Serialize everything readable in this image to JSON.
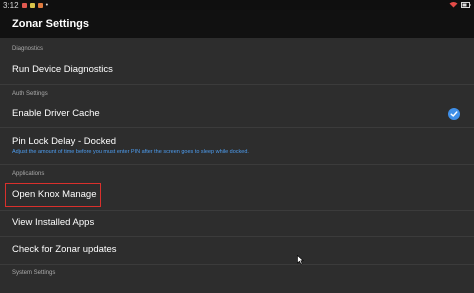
{
  "status_bar": {
    "time": "3:12",
    "left_icons": [
      "notification-icon",
      "notification-icon",
      "notification-icon",
      "more-dots-icon"
    ],
    "right_icons": [
      "wifi-icon",
      "battery-icon"
    ]
  },
  "app_bar": {
    "title": "Zonar Settings"
  },
  "sections": {
    "diagnostics": {
      "header": "Diagnostics",
      "run_diagnostics": "Run Device Diagnostics"
    },
    "auth": {
      "header": "Auth Settings",
      "driver_cache": "Enable Driver Cache",
      "driver_cache_checked": true,
      "pin_lock": "Pin Lock Delay - Docked",
      "pin_lock_sub": "Adjust the amount of time before you must enter PIN after the screen goes to sleep while docked."
    },
    "applications": {
      "header": "Applications",
      "knox": "Open Knox Manage",
      "installed_apps": "View Installed Apps",
      "updates": "Check for Zonar updates"
    },
    "system": {
      "header": "System Settings"
    }
  },
  "colors": {
    "accent": "#3f8fe8",
    "highlight": "#d9302c",
    "background": "#2d2d2d",
    "app_bar": "#111111"
  }
}
